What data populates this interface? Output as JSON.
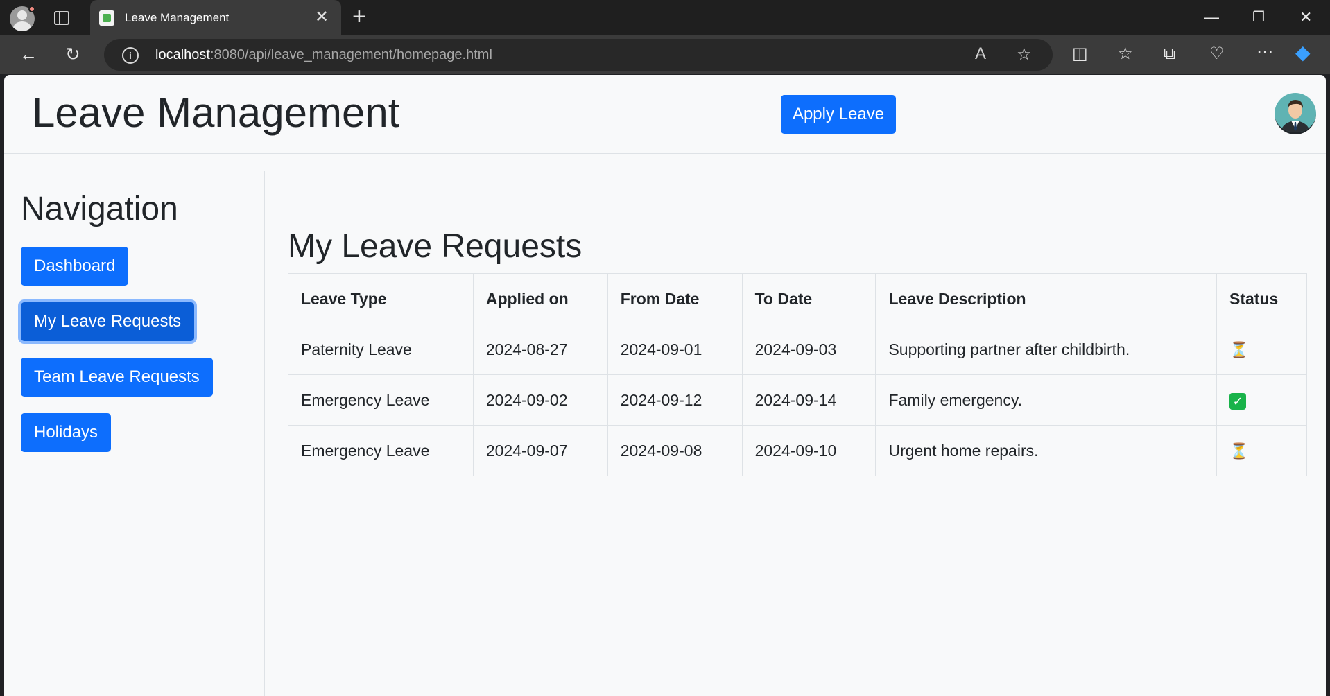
{
  "browser": {
    "tab_title": "Leave Management",
    "url_host": "localhost",
    "url_rest": ":8080/api/leave_management/homepage.html"
  },
  "header": {
    "brand": "Leave Management",
    "apply_label": "Apply Leave"
  },
  "sidebar": {
    "title": "Navigation",
    "items": [
      {
        "label": "Dashboard"
      },
      {
        "label": "My Leave Requests",
        "active": true
      },
      {
        "label": "Team Leave Requests"
      },
      {
        "label": "Holidays"
      }
    ]
  },
  "main": {
    "title": "My Leave Requests",
    "columns": [
      "Leave Type",
      "Applied on",
      "From Date",
      "To Date",
      "Leave Description",
      "Status"
    ],
    "rows": [
      {
        "type": "Paternity Leave",
        "applied": "2024-08-27",
        "from": "2024-09-01",
        "to": "2024-09-03",
        "description": "Supporting partner after childbirth.",
        "status": "pending"
      },
      {
        "type": "Emergency Leave",
        "applied": "2024-09-02",
        "from": "2024-09-12",
        "to": "2024-09-14",
        "description": "Family emergency.",
        "status": "approved"
      },
      {
        "type": "Emergency Leave",
        "applied": "2024-09-07",
        "from": "2024-09-08",
        "to": "2024-09-10",
        "description": "Urgent home repairs.",
        "status": "pending"
      }
    ]
  },
  "icons": {
    "pending": "hourglass-icon",
    "approved": "check-icon"
  },
  "colors": {
    "primary": "#0d6efd",
    "approved": "#19b34a"
  }
}
